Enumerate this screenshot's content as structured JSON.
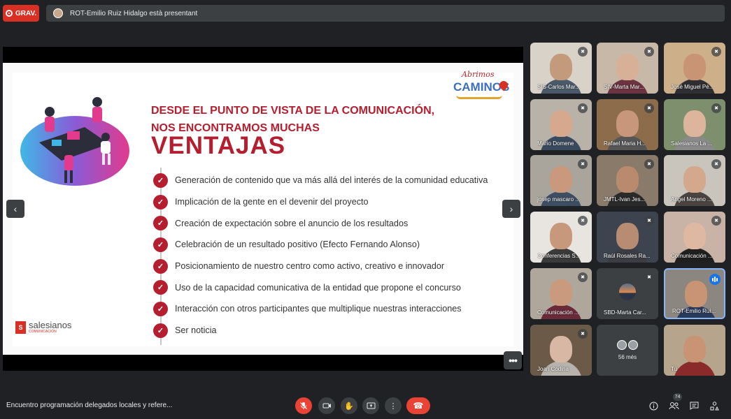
{
  "recording": {
    "label": "GRAV."
  },
  "presenter_banner": {
    "text": "ROT-Emilio Ruiz Hidalgo està presentant"
  },
  "slide": {
    "logo_script": "Abrimos",
    "logo_main": "CAMINOS",
    "heading_line1": "DESDE EL PUNTO DE VISTA DE LA COMUNICACIÓN,",
    "heading_line2": "NOS ENCONTRAMOS MUCHAS",
    "heading_big": "VENTAJAS",
    "items": [
      "Generación de contenido que va más allá del interés de la comunidad educativa",
      "Implicación de la gente en el devenir del proyecto",
      "Creación de expectación sobre el anuncio de los resultados",
      "Celebración de un resultado positivo (Efecto Fernando Alonso)",
      "Posicionamiento de nuestro centro como activo, creativo e innovador",
      "Uso de la capacidad comunicativa de la entidad que propone el concurso",
      "Interacción con otros participantes que multiplique nuestras interacciones",
      "Ser noticia"
    ],
    "brand_name": "salesianos",
    "brand_sub": "COMUNICACIÓN",
    "brand_mark": "S"
  },
  "participants": [
    {
      "name": "SIS-Carlos Mar...",
      "muted": true,
      "skin": "#c49a7c",
      "shirt": "#4a5a6a",
      "bg": "#d9d2c8"
    },
    {
      "name": "SIV-Marta Mar...",
      "muted": true,
      "skin": "#d8b097",
      "shirt": "#6d3340",
      "bg": "#c8b8a8"
    },
    {
      "name": "José Miguel Pé...",
      "muted": true,
      "skin": "#c89474",
      "shirt": "#2f2f33",
      "bg": "#cdb089"
    },
    {
      "name": "Mario Domene",
      "muted": true,
      "skin": "#d6a88e",
      "shirt": "#3a4a5e",
      "bg": "#b9b2a8"
    },
    {
      "name": "Rafael Maria H...",
      "muted": true,
      "skin": "#c8967a",
      "shirt": "#565656",
      "bg": "#8d6c4c"
    },
    {
      "name": "Salesianos La ...",
      "muted": true,
      "skin": "#dcb59c",
      "shirt": "#8a8a8a",
      "bg": "#7e8f6e"
    },
    {
      "name": "josep mascaro ...",
      "muted": true,
      "skin": "#c9987d",
      "shirt": "#3d4e63",
      "bg": "#a9a49c"
    },
    {
      "name": "JMTL-Ivan Jes...",
      "muted": true,
      "skin": "#b98a6e",
      "shirt": "#2a2a2a",
      "bg": "#8a7a6a"
    },
    {
      "name": "Angel Moreno ...",
      "muted": true,
      "skin": "#d4a88c",
      "shirt": "#4a4440",
      "bg": "#c9c4bc"
    },
    {
      "name": "Conferencias S...",
      "muted": true,
      "skin": "#c8987c",
      "shirt": "#3a3a3a",
      "bg": "#e8e4e0"
    },
    {
      "name": "Raúl Rosales Ra...",
      "muted": true,
      "skin": "#b88c72",
      "shirt": "#3c3c44",
      "bg": "#3d4450"
    },
    {
      "name": "Comunicación ...",
      "muted": true,
      "skin": "#dfb8a2",
      "shirt": "#1f1f1f",
      "bg": "#c9b3a6"
    },
    {
      "name": "Comunicación ...",
      "muted": true,
      "skin": "#c99a7e",
      "shirt": "#6a2a3a",
      "bg": "#b0a79c"
    },
    {
      "name": "SBD-Marta Car...",
      "muted": true,
      "avatar": true
    },
    {
      "name": "ROT-Emilio Ruí...",
      "muted": false,
      "speaking": true,
      "skin": "#c89474",
      "shirt": "#2a3a5a",
      "bg": "#8c8680"
    },
    {
      "name": "Joan Codina",
      "muted": true,
      "skin": "#d8b8a4",
      "shirt": "#b7b2ac",
      "bg": "#6c5a48"
    },
    {
      "more": true,
      "label": "56 més"
    },
    {
      "name": "Tú",
      "muted": false,
      "skin": "#c89474",
      "shirt": "#8a2a2a",
      "bg": "#b7a48c"
    }
  ],
  "meeting": {
    "title": "Encuentro programación delegados locales y refere..."
  },
  "participants_count": "74",
  "colors": {
    "accent_red": "#b51e2e",
    "control_red": "#ea4335",
    "speaking_blue": "#1a73e8"
  }
}
